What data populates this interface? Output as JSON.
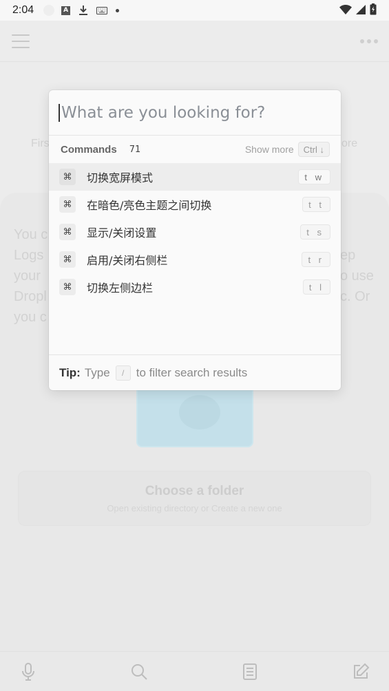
{
  "status_bar": {
    "time": "2:04",
    "a_icon_letter": "A"
  },
  "background": {
    "first_fragment": "Firs",
    "more_fragment": "ore",
    "para_left": [
      "You c",
      "Logs",
      "your",
      "Dropl",
      "you c"
    ],
    "para_right": [
      "ep",
      "o use",
      "c. Or"
    ],
    "choose_title": "Choose a folder",
    "choose_sub": "Open existing directory or Create a new one"
  },
  "search": {
    "placeholder": "What are you looking for?",
    "value": ""
  },
  "commands": {
    "title": "Commands",
    "count": "71",
    "show_more_label": "Show more",
    "show_more_kbd": "Ctrl ↓",
    "items": [
      {
        "icon": "⌘",
        "label": "切换宽屏模式",
        "shortcut": "t w"
      },
      {
        "icon": "⌘",
        "label": "在暗色/亮色主题之间切换",
        "shortcut": "t t"
      },
      {
        "icon": "⌘",
        "label": "显示/关闭设置",
        "shortcut": "t s"
      },
      {
        "icon": "⌘",
        "label": "启用/关闭右侧栏",
        "shortcut": "t r"
      },
      {
        "icon": "⌘",
        "label": "切换左侧边栏",
        "shortcut": "t l"
      }
    ]
  },
  "tip": {
    "label": "Tip:",
    "pre": "Type",
    "key": "/",
    "post": "to filter search results"
  },
  "colors": {
    "accent_illustration": "#c4e0ea",
    "text_primary": "#333333",
    "text_muted": "#8a8f96"
  }
}
